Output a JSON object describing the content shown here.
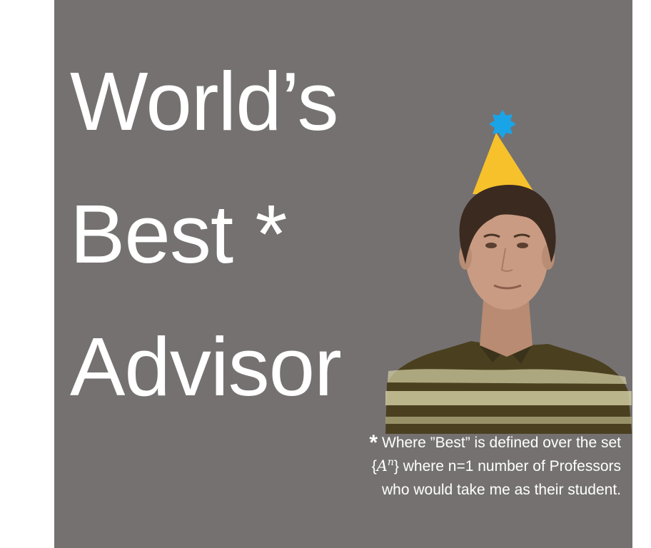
{
  "colors": {
    "background": "#757171",
    "text": "#ffffff",
    "hat": "#f6c12b",
    "hat_star": "#1aa4e8",
    "shirt_dark": "#4a4020",
    "shirt_light": "#d6d3a8"
  },
  "headline": {
    "line1": "World’s",
    "line2": "Best *",
    "line3": "Advisor"
  },
  "footnote": {
    "asterisk": "*",
    "line1": "Where ”Best” is defined over the set",
    "set_open": "{",
    "set_symbol": "A",
    "set_exponent": "n",
    "set_close": "}",
    "line2_rest": " where n=1 number of Professors",
    "line3": "who would take me as their student."
  },
  "portrait": {
    "icon": "party-hat-icon",
    "subject": "person-photo"
  }
}
